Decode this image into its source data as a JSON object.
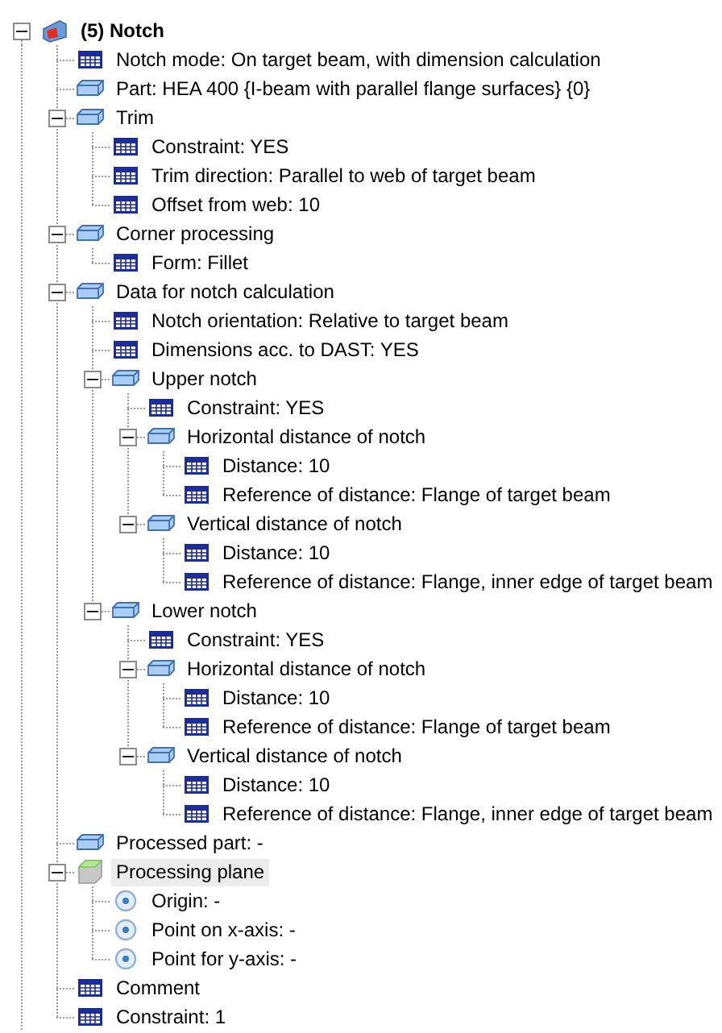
{
  "tree": [
    {
      "kind": "root",
      "label": "(5) Notch",
      "selected": false,
      "expanded": true,
      "children": [
        {
          "kind": "param",
          "label": "Notch mode: On target beam,  with dimension calculation",
          "selected": false
        },
        {
          "kind": "group",
          "label": "Part: HEA 400 {I-beam with parallel flange surfaces} {0}",
          "selected": false
        },
        {
          "kind": "group",
          "label": "Trim",
          "selected": false,
          "expanded": true,
          "children": [
            {
              "kind": "param",
              "label": "Constraint: YES",
              "selected": false
            },
            {
              "kind": "param",
              "label": "Trim direction: Parallel to web of target beam",
              "selected": false
            },
            {
              "kind": "param",
              "label": "Offset from web: 10",
              "selected": false
            }
          ]
        },
        {
          "kind": "group",
          "label": "Corner processing",
          "selected": false,
          "expanded": true,
          "children": [
            {
              "kind": "param",
              "label": "Form: Fillet",
              "selected": false
            }
          ]
        },
        {
          "kind": "group",
          "label": "Data for notch calculation",
          "selected": false,
          "expanded": true,
          "children": [
            {
              "kind": "param",
              "label": "Notch orientation: Relative to target beam",
              "selected": false
            },
            {
              "kind": "param",
              "label": "Dimensions acc. to DAST: YES",
              "selected": false
            },
            {
              "kind": "group",
              "label": "Upper notch",
              "selected": false,
              "expanded": true,
              "children": [
                {
                  "kind": "param",
                  "label": "Constraint: YES",
                  "selected": false
                },
                {
                  "kind": "group",
                  "label": "Horizontal distance of notch",
                  "selected": false,
                  "expanded": true,
                  "children": [
                    {
                      "kind": "param",
                      "label": "Distance: 10",
                      "selected": false
                    },
                    {
                      "kind": "param",
                      "label": "Reference of distance: Flange of target beam",
                      "selected": false
                    }
                  ]
                },
                {
                  "kind": "group",
                  "label": "Vertical distance of notch",
                  "selected": false,
                  "expanded": true,
                  "children": [
                    {
                      "kind": "param",
                      "label": "Distance: 10",
                      "selected": false
                    },
                    {
                      "kind": "param",
                      "label": "Reference of distance: Flange, inner edge of target beam",
                      "selected": false
                    }
                  ]
                }
              ]
            },
            {
              "kind": "group",
              "label": "Lower notch",
              "selected": false,
              "expanded": true,
              "children": [
                {
                  "kind": "param",
                  "label": "Constraint: YES",
                  "selected": false
                },
                {
                  "kind": "group",
                  "label": "Horizontal distance of notch",
                  "selected": false,
                  "expanded": true,
                  "children": [
                    {
                      "kind": "param",
                      "label": "Distance: 10",
                      "selected": false
                    },
                    {
                      "kind": "param",
                      "label": "Reference of distance: Flange of target beam",
                      "selected": false
                    }
                  ]
                },
                {
                  "kind": "group",
                  "label": "Vertical distance of notch",
                  "selected": false,
                  "expanded": true,
                  "children": [
                    {
                      "kind": "param",
                      "label": "Distance: 10",
                      "selected": false
                    },
                    {
                      "kind": "param",
                      "label": "Reference of distance: Flange, inner edge of target beam",
                      "selected": false
                    }
                  ]
                }
              ]
            }
          ]
        },
        {
          "kind": "group",
          "label": "Processed part: -",
          "selected": false
        },
        {
          "kind": "plane",
          "label": "Processing plane",
          "selected": true,
          "expanded": true,
          "children": [
            {
              "kind": "point",
              "label": "Origin: -",
              "selected": false
            },
            {
              "kind": "point",
              "label": "Point on x-axis: -",
              "selected": false
            },
            {
              "kind": "point",
              "label": "Point for y-axis: -",
              "selected": false
            }
          ]
        },
        {
          "kind": "param",
          "label": "Comment",
          "selected": false
        },
        {
          "kind": "param",
          "label": "Constraint: 1",
          "selected": false
        }
      ]
    }
  ]
}
